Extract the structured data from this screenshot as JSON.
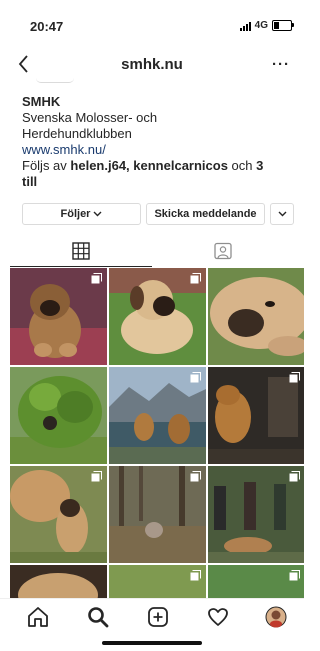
{
  "status": {
    "time": "20:47",
    "network": "4G"
  },
  "header": {
    "title": "smhk.nu"
  },
  "profile": {
    "name": "SMHK",
    "bio_line1": "Svenska Molosser- och",
    "bio_line2": "Herdehundklubben",
    "website": "www.smhk.nu/",
    "followed_prefix": "Följs av ",
    "followed_user1": "helen.j64",
    "followed_sep": ", ",
    "followed_user2": "kennelcarnicos",
    "followed_mid": " och ",
    "followed_count": "3",
    "followed_line2": "till"
  },
  "actions": {
    "follow_label": "Följer",
    "message_label": "Skicka meddelande"
  },
  "icons": [
    "chevron-left-icon",
    "more-icon",
    "grid-icon",
    "tagged-icon",
    "home-icon",
    "search-icon",
    "add-icon",
    "heart-icon",
    "profile-icon",
    "chevron-down-icon",
    "multiple-posts-icon"
  ],
  "colors": {
    "link": "#1a3b6e",
    "border": "#dbdbdb",
    "text": "#262626"
  },
  "posts": [
    {
      "subject": "mastiff puppy on red blanket",
      "multiple": true
    },
    {
      "subject": "mastiff puppy lying on grass",
      "multiple": true
    },
    {
      "subject": "mastiff head resting on grass",
      "multiple": false
    },
    {
      "subject": "dog hiding in green bush",
      "multiple": false
    },
    {
      "subject": "two dogs by mountain lake",
      "multiple": true
    },
    {
      "subject": "dog in dark room",
      "multiple": true
    },
    {
      "subject": "adult dog with puppy",
      "multiple": true
    },
    {
      "subject": "dog in forest",
      "multiple": true
    },
    {
      "subject": "people with dogs in forest",
      "multiple": true
    },
    {
      "subject": "food on plate",
      "multiple": false
    },
    {
      "subject": "grass field",
      "multiple": true
    },
    {
      "subject": "green field",
      "multiple": true
    }
  ]
}
